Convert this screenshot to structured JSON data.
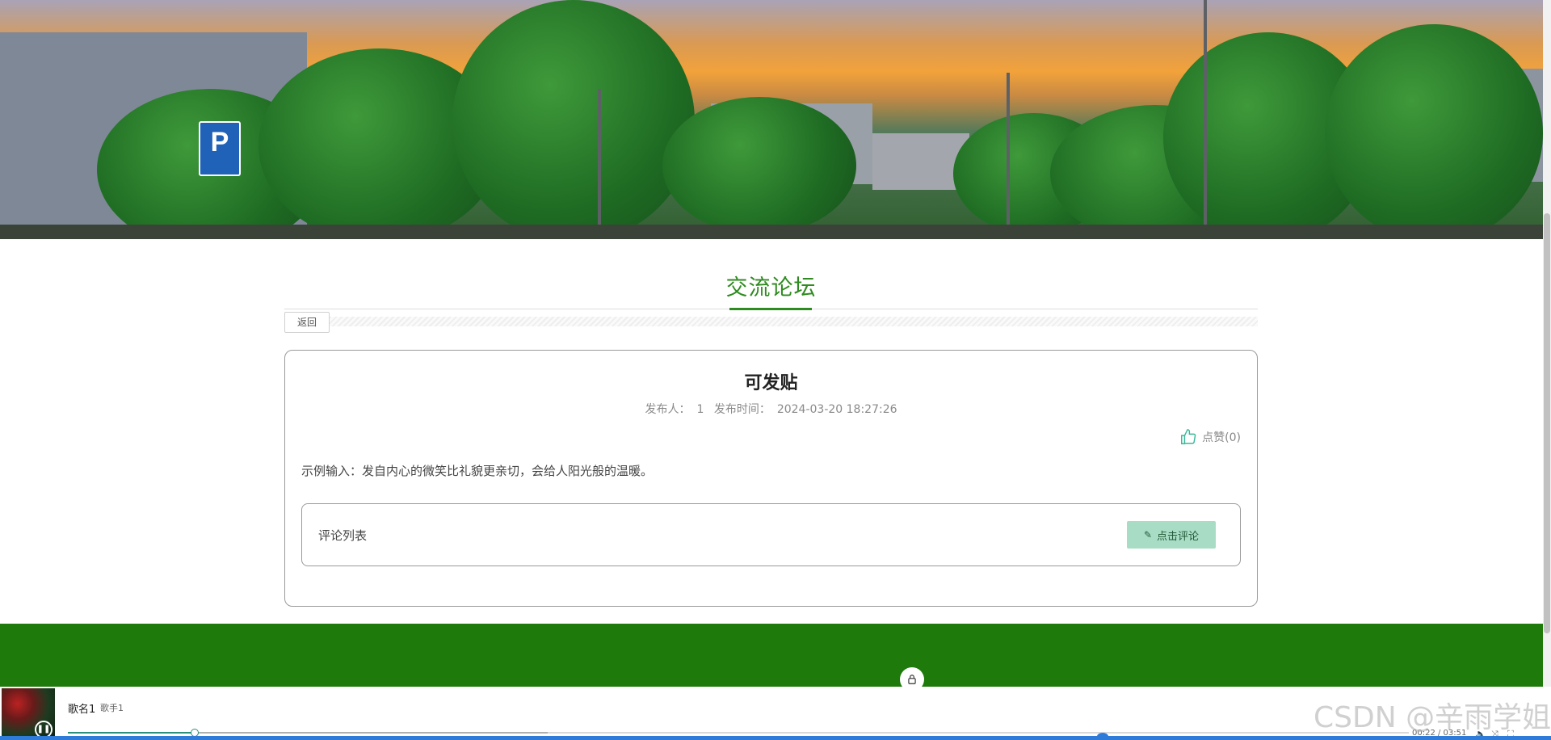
{
  "banner": {
    "sign_text": "P"
  },
  "forum": {
    "section_title": "交流论坛",
    "back_label": "返回"
  },
  "post": {
    "title": "可发贴",
    "author_label": "发布人：",
    "author": "1",
    "time_label": "发布时间：",
    "time": "2024-03-20 18:27:26",
    "like_label": "点赞(0)",
    "content": "示例输入：发自内心的微笑比礼貌更亲切，会给人阳光般的温暖。"
  },
  "comments": {
    "list_label": "评论列表",
    "comment_button_label": "点击评论"
  },
  "player": {
    "song": "歌名1",
    "artist": "歌手1",
    "time": "00:22 / 03:51",
    "progress_fraction": 0.095
  },
  "watermark": "CSDN @辛雨学姐",
  "colors": {
    "accent_green": "#2e8b1f",
    "footer_green": "#1f7a0c",
    "comment_button_bg": "#a8dcc5"
  },
  "icons": [
    "thumbs-up-icon",
    "pencil-icon",
    "lock-icon",
    "pause-icon",
    "volume-icon",
    "fullscreen-icon"
  ]
}
